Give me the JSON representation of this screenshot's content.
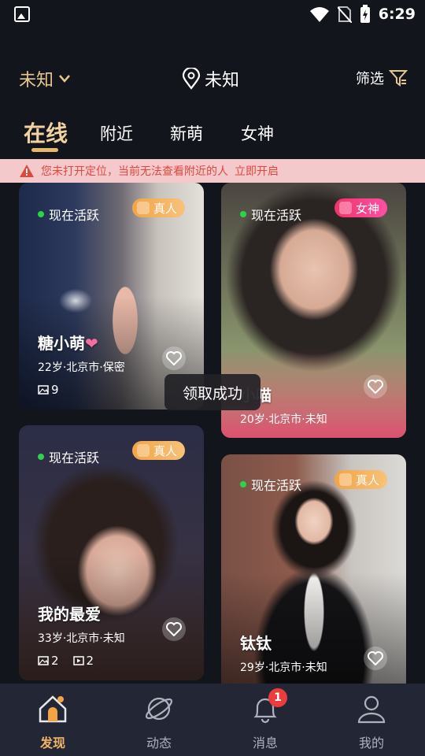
{
  "status_bar": {
    "time": "6:29",
    "icons": [
      "notification-image-icon",
      "wifi-icon",
      "no-sim-icon",
      "battery-charging-icon"
    ]
  },
  "header": {
    "city": "未知",
    "location": "未知",
    "filter_label": "筛选"
  },
  "tabs": [
    {
      "label": "在线",
      "active": true
    },
    {
      "label": "附近",
      "active": false
    },
    {
      "label": "新萌",
      "active": false
    },
    {
      "label": "女神",
      "active": false
    }
  ],
  "location_warning": {
    "text": "您未打开定位，当前无法查看附近的人",
    "action": "立即开启"
  },
  "cards": [
    {
      "status": "现在活跃",
      "badge": "真人",
      "name": "糖小萌",
      "info": "22岁·北京市·保密",
      "photos": "9"
    },
    {
      "status": "现在活跃",
      "badge": "女神",
      "name": "小喵",
      "info": "20岁·北京市·未知"
    },
    {
      "status": "现在活跃",
      "badge": "真人",
      "name": "我的最爱",
      "info": "33岁·北京市·未知",
      "photos": "2",
      "videos": "2"
    },
    {
      "status": "现在活跃",
      "badge": "真人",
      "name": "钛钛",
      "info": "29岁·北京市·未知"
    }
  ],
  "toast": "领取成功",
  "bottom_nav": [
    {
      "label": "发现",
      "active": true
    },
    {
      "label": "动态",
      "active": false
    },
    {
      "label": "消息",
      "active": false,
      "badge": "1"
    },
    {
      "label": "我的",
      "active": false
    }
  ],
  "colors": {
    "accent": "#f0b36a",
    "background": "#13151c",
    "nav": "#232735",
    "warning_bg": "#f4c9cc",
    "warning_text": "#e2473c"
  }
}
